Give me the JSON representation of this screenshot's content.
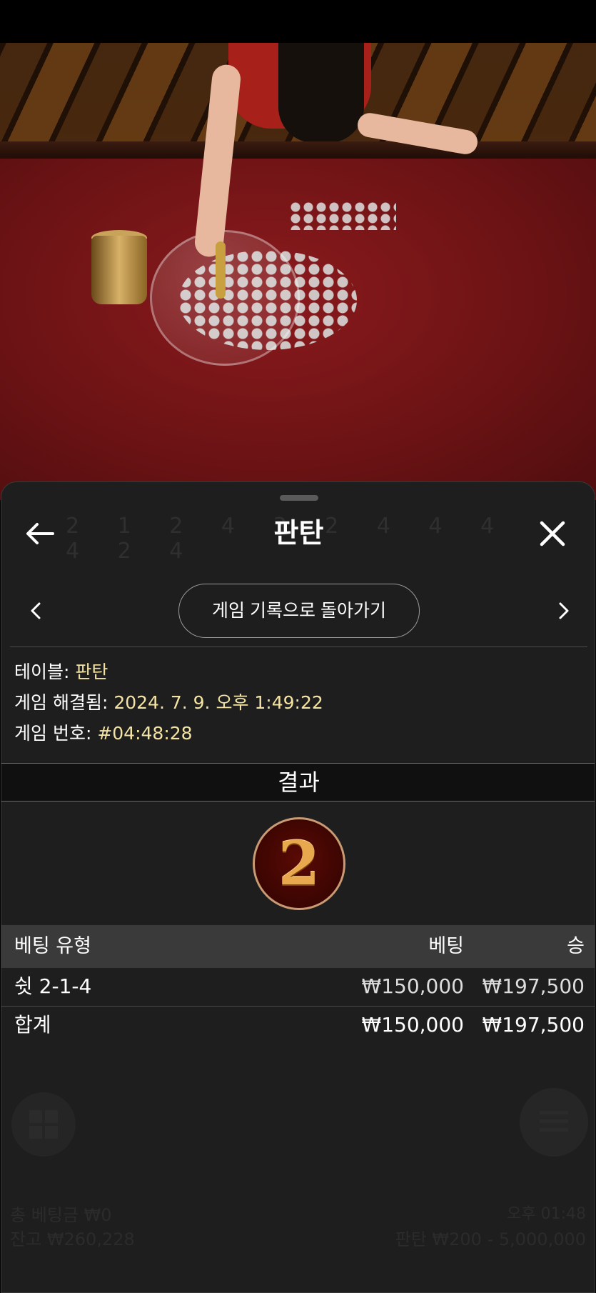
{
  "sheet": {
    "title": "판탄",
    "history_button": "게임 기록으로 돌아가기",
    "info": {
      "table_label": "테이블: ",
      "table_value": "판탄",
      "resolved_label": "게임 해결됨: ",
      "resolved_value": "2024. 7. 9. 오후 1:49:22",
      "game_no_label": "게임 번호: ",
      "game_no_value": "#04:48:28"
    },
    "result_heading": "결과",
    "result_number": "2",
    "table": {
      "headers": [
        "베팅 유형",
        "베팅",
        "승"
      ],
      "rows": [
        {
          "type": "쉿 2-1-4",
          "bet": "₩150,000",
          "win": "₩197,500"
        }
      ],
      "total": {
        "label": "합계",
        "bet": "₩150,000",
        "win": "₩197,500"
      }
    }
  },
  "background_ui": {
    "roadmap_digits": "2 1 2 4 3 2 4 4 4 4 2 4",
    "total_bet": "총 베팅금 ₩0",
    "balance": "잔고 ₩260,228",
    "time": "오후 01:48",
    "limits": "판탄 ₩200 - 5,000,000"
  },
  "icons": [
    "back-arrow-icon",
    "close-icon",
    "chevron-left-icon",
    "chevron-right-icon",
    "grid-icon",
    "menu-icon"
  ],
  "colors": {
    "sheet_bg": "#1e1e1e",
    "accent_text": "#f3e3a4",
    "medal_bg": "#3b0502",
    "medal_gold": "#e8a94e"
  }
}
